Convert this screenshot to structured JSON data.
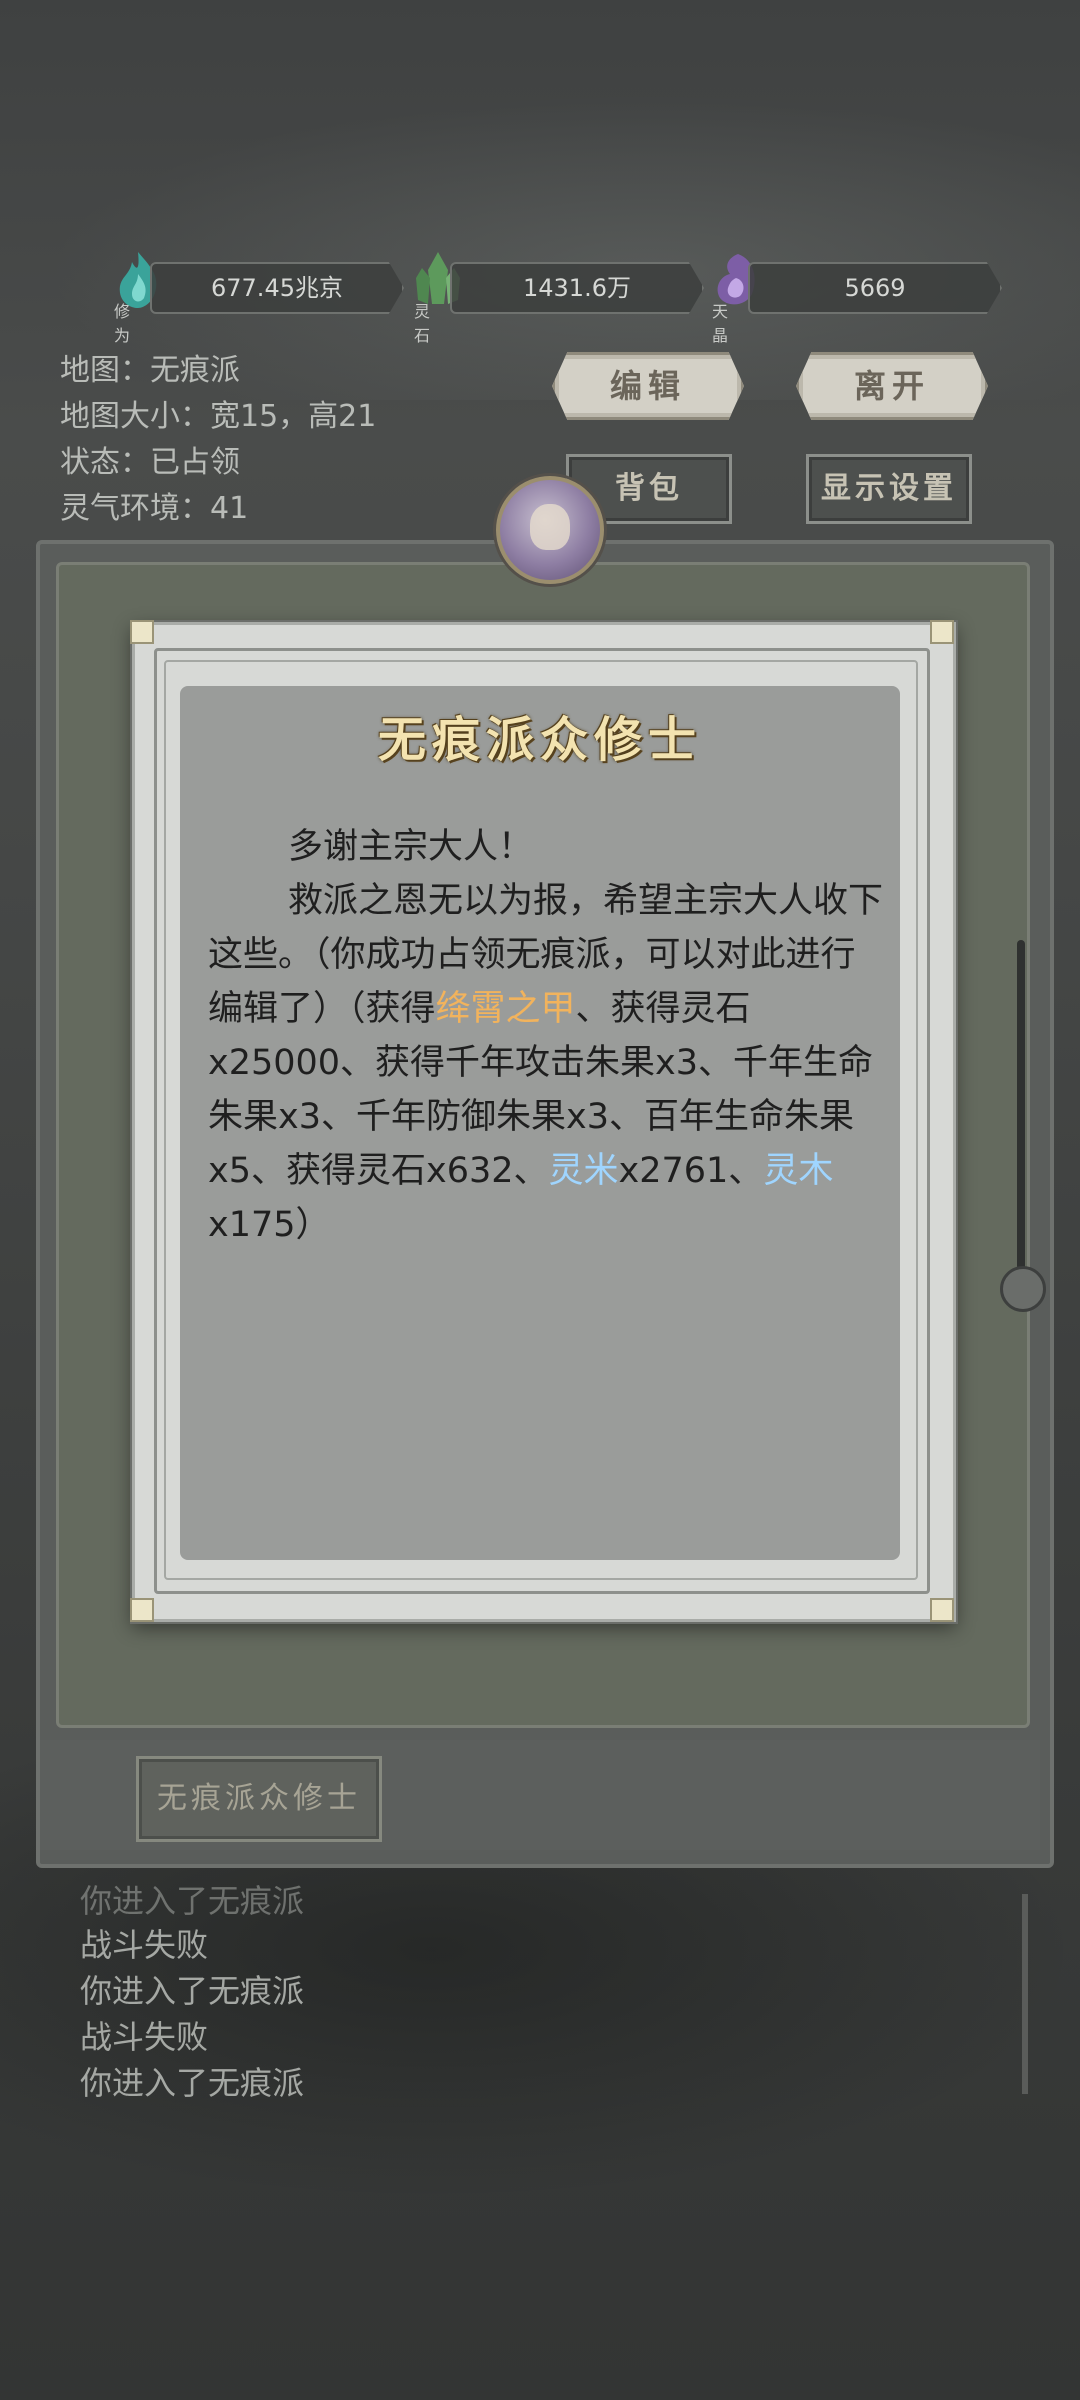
{
  "resources": [
    {
      "name": "修为",
      "value": "677.45兆京",
      "icon": "cultivation-flame-icon",
      "color": "#4fb6a8"
    },
    {
      "name": "灵石",
      "value": "1431.6万",
      "icon": "spirit-stone-crystal-icon",
      "color": "#6aa067"
    },
    {
      "name": "天晶",
      "value": "5669",
      "icon": "heaven-crystal-icon",
      "color": "#8e6fb0"
    }
  ],
  "map_info": {
    "map": "地图：无痕派",
    "size": "地图大小：宽15，高21",
    "status": "状态：已占领",
    "aura": "灵气环境：41"
  },
  "buttons": {
    "edit": "编辑",
    "leave": "离开",
    "backpack": "背包",
    "display_settings": "显示设置",
    "npc": "无痕派众修士"
  },
  "dialog": {
    "title": "无痕派众修士",
    "line1": "多谢主宗大人！",
    "p2_a": "救派之恩无以为报，希望主宗大人收下这些。（你成功占领无痕派，可以对此进行编辑了）（获得",
    "item1": "绛霄之甲",
    "p2_b": "、获得灵石x25000、获得千年攻击朱果x3、千年生命朱果x3、千年防御朱果x3、百年生命朱果x5、获得灵石x632、",
    "item2": "灵米",
    "p2_c": "x2761、",
    "item3": "灵木",
    "p2_d": "x175）"
  },
  "log": [
    "你进入了无痕派",
    "战斗失败",
    "你进入了无痕派",
    "战斗失败",
    "你进入了无痕派"
  ],
  "colors": {
    "highlight_gold": "#f2b35c",
    "highlight_blue": "#9fd5ff",
    "title_gold": "#f3e3b0"
  }
}
